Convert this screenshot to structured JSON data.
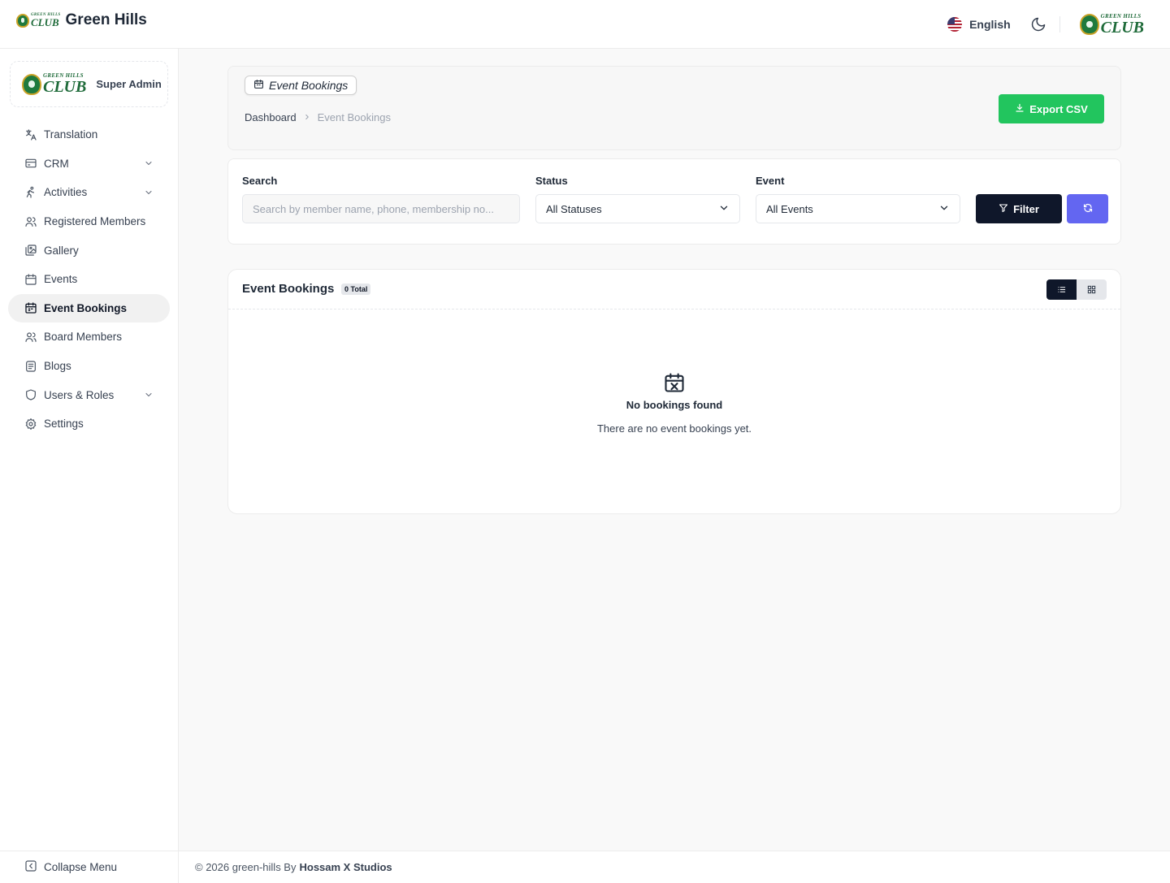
{
  "header": {
    "brand_title": "Green Hills",
    "logo_small": "GREEN HILLS",
    "logo_big": "CLUB",
    "language": "English"
  },
  "sidebar": {
    "profile_role": "Super Admin",
    "items": [
      {
        "label": "Translation",
        "icon": "translate-icon",
        "has_chevron": false
      },
      {
        "label": "CRM",
        "icon": "credit-card-icon",
        "has_chevron": true
      },
      {
        "label": "Activities",
        "icon": "running-icon",
        "has_chevron": true
      },
      {
        "label": "Registered Members",
        "icon": "users-icon",
        "has_chevron": false
      },
      {
        "label": "Gallery",
        "icon": "gallery-icon",
        "has_chevron": false
      },
      {
        "label": "Events",
        "icon": "calendar-icon",
        "has_chevron": false
      },
      {
        "label": "Event Bookings",
        "icon": "calendar-check-icon",
        "has_chevron": false,
        "active": true
      },
      {
        "label": "Board Members",
        "icon": "users-icon",
        "has_chevron": false
      },
      {
        "label": "Blogs",
        "icon": "blog-icon",
        "has_chevron": false
      },
      {
        "label": "Users & Roles",
        "icon": "shield-icon",
        "has_chevron": true
      },
      {
        "label": "Settings",
        "icon": "gear-icon",
        "has_chevron": false
      }
    ],
    "collapse_label": "Collapse Menu"
  },
  "page": {
    "chip_label": "Event Bookings",
    "breadcrumb": [
      "Dashboard",
      "Event Bookings"
    ],
    "export_label": "Export CSV"
  },
  "filters": {
    "search_label": "Search",
    "search_placeholder": "Search by member name, phone, membership no...",
    "status_label": "Status",
    "status_value": "All Statuses",
    "event_label": "Event",
    "event_value": "All Events",
    "filter_label": "Filter"
  },
  "list": {
    "title": "Event Bookings",
    "total_badge": "0 Total",
    "empty_title": "No bookings found",
    "empty_subtitle": "There are no event bookings yet."
  },
  "footer": {
    "copyright": "© 2026 green-hills By",
    "company": "Hossam X Studios"
  },
  "colors": {
    "accent_green": "#22c55e",
    "filter_dark": "#0f172a",
    "reset_indigo": "#6366f1",
    "brand_green": "#1f6b3a"
  }
}
